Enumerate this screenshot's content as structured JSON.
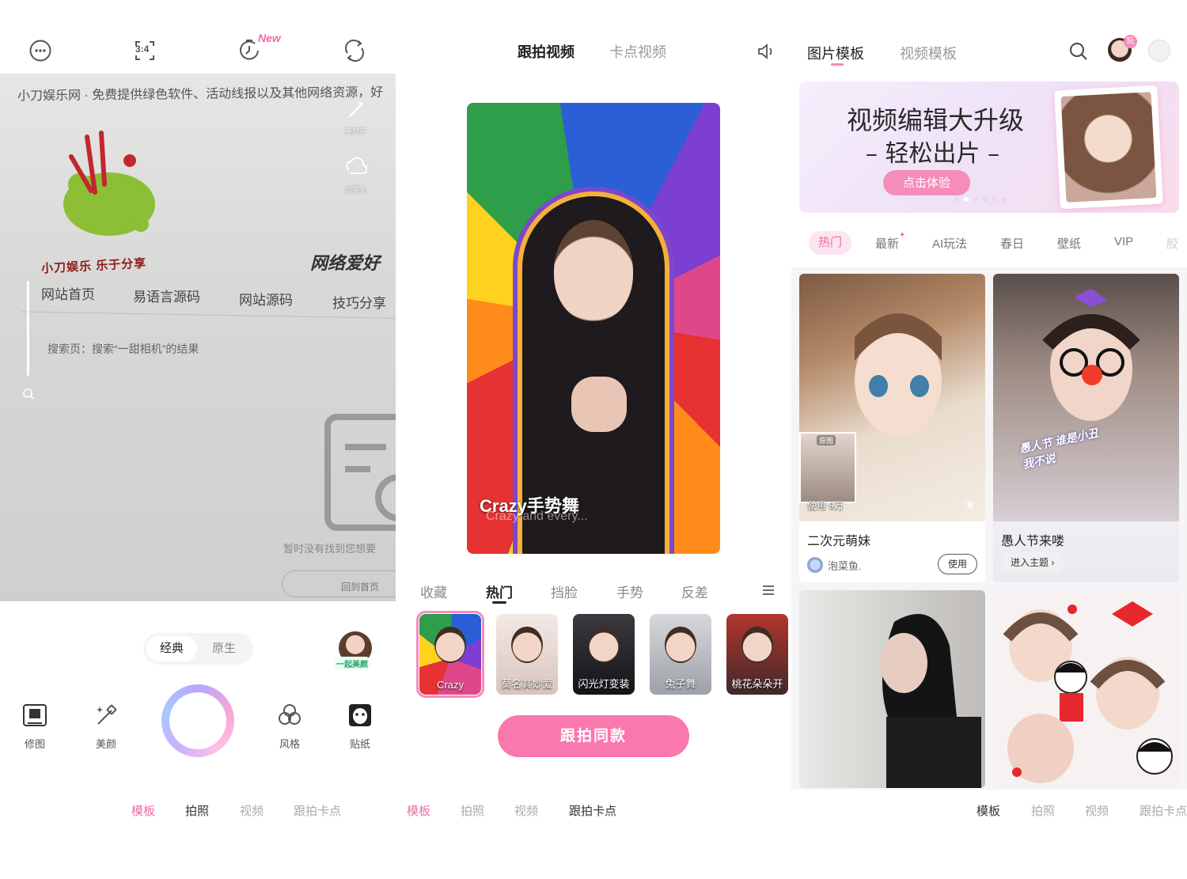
{
  "panel1": {
    "top_icons": [
      "more-dots-icon",
      "aspect-ratio-icon",
      "timer-icon",
      "flip-camera-icon"
    ],
    "aspect_label": "3:4",
    "new_tag": "New",
    "viewfinder": {
      "banner_text": "小刀娱乐网 · 免费提供绿色软件、活动线报以及其他网络资源，好",
      "logo_text": "小刀娱乐 乐于分享",
      "handwriting": "网络爱好",
      "nav_items": [
        "网站首页",
        "易语言源码",
        "网站源码",
        "技巧分享"
      ],
      "search_result": "搜索页：搜索“一甜相机”的结果",
      "empty_text": "暂时没有找到您想要",
      "back_home": "回到首页",
      "side_caption_beauty": "美颜开",
      "side_caption_weather": "云雾关"
    },
    "mode_switch": {
      "active": "经典",
      "inactive": "原生"
    },
    "avatar_tag": "一起美颜",
    "tools": [
      {
        "label": "修图",
        "icon": "photo-edit-icon"
      },
      {
        "label": "美颜",
        "icon": "beauty-wand-icon"
      },
      {
        "label": "风格",
        "icon": "style-filter-icon"
      },
      {
        "label": "贴纸",
        "icon": "sticker-icon"
      }
    ],
    "bottom_nav": [
      "模板",
      "拍照",
      "视频",
      "跟拍卡点"
    ]
  },
  "panel2": {
    "tabs": {
      "active": "跟拍视频",
      "inactive": "卡点视频"
    },
    "video": {
      "title": "Crazy手势舞",
      "subtitle": "Crazy and every..."
    },
    "categories": [
      "收藏",
      "热门",
      "挡脸",
      "手势",
      "反差"
    ],
    "active_category": "热门",
    "thumbnails": [
      "Crazy",
      "莫名其妙爱",
      "闪光灯变装",
      "兔子舞",
      "桃花朵朵开"
    ],
    "cta": "跟拍同款",
    "bottom_nav": [
      "模板",
      "拍照",
      "视频",
      "跟拍卡点"
    ]
  },
  "panel3": {
    "tabs": {
      "active": "图片模板",
      "inactive": "视频模板"
    },
    "play_badge": "玩",
    "banner": {
      "line1": "视频编辑大升级",
      "line2": "– 轻松出片 –",
      "button": "点击体验"
    },
    "categories": [
      "热门",
      "最新",
      "AI玩法",
      "春日",
      "壁纸",
      "VIP",
      "胶"
    ],
    "cards": [
      {
        "title": "二次元萌妹",
        "author": "泡菜鱼.",
        "button": "使用",
        "used": "使用 9万",
        "original_tag": "原图"
      },
      {
        "title": "愚人节来喽",
        "button": "进入主题",
        "sticker_text": "愚人节 谁是小丑 我不说"
      }
    ],
    "bottom_nav": [
      "模板",
      "拍照",
      "视频",
      "跟拍卡点"
    ]
  },
  "colors": {
    "accent_pink": "#f978ad",
    "soft_pink": "#fde5ef"
  }
}
